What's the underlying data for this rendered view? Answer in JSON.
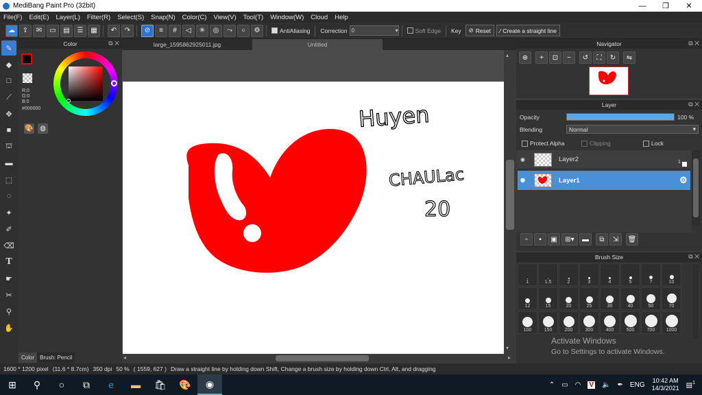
{
  "window": {
    "title": "MediBang Paint Pro (32bit)",
    "controls": [
      "—",
      "❐",
      "✕"
    ]
  },
  "menu": [
    "File(F)",
    "Edit(E)",
    "Layer(L)",
    "Filter(R)",
    "Select(S)",
    "Snap(N)",
    "Color(C)",
    "View(V)",
    "Tool(T)",
    "Window(W)",
    "Cloud",
    "Help"
  ],
  "toolbar": {
    "antialiasing": "AntiAliasing",
    "correction_label": "Correction",
    "correction_value": "0",
    "soft_edge": "Soft Edge",
    "key": "Key",
    "reset": "Reset",
    "straight_line": "Create a straight line"
  },
  "color_panel": {
    "title": "Color",
    "r": "R:0",
    "g": "G:0",
    "b": "B:0",
    "hex": "#000000",
    "tabs": [
      "Color",
      "Brush: Pencil"
    ]
  },
  "doc_tabs": [
    "large_1595862925011.jpg",
    "Untitled"
  ],
  "drawing_text": {
    "line1": "Huyen",
    "line2": "CHAULac",
    "line3": "20"
  },
  "navigator": {
    "title": "Navigator"
  },
  "layer_panel": {
    "title": "Layer",
    "opacity_label": "Opacity",
    "opacity_value": "100 %",
    "opacity_fraction": 1.0,
    "blending_label": "Blending",
    "blending_value": "Normal",
    "protect_alpha": "Protect Alpha",
    "clipping": "Clipping",
    "lock": "Lock",
    "layers": [
      "Layer2",
      "Layer1"
    ],
    "layer2_badge": "1"
  },
  "brush_panel": {
    "title": "Brush Size",
    "sizes": [
      "1",
      "1.5",
      "2",
      "3",
      "4",
      "5",
      "7",
      "10",
      "12",
      "15",
      "20",
      "25",
      "30",
      "40",
      "50",
      "70",
      "100",
      "150",
      "200",
      "300",
      "400",
      "500",
      "700",
      "1000"
    ]
  },
  "status": {
    "dimensions": "1600 * 1200 pixel",
    "physical": "(11.6 * 8.7cm)",
    "dpi": "350 dpi",
    "zoom": "50 %",
    "coords": "( 1559, 627 )",
    "hint": "Draw a straight line by holding down Shift, Change a brush size by holding down Ctrl, Alt, and dragging"
  },
  "watermark": {
    "title": "Activate Windows",
    "sub": "Go to Settings to activate Windows."
  },
  "taskbar": {
    "lang": "ENG",
    "time": "10:42 AM",
    "date": "14/3/2021",
    "notif_count": "1"
  },
  "colors": {
    "accent": "#3d7cd0",
    "heart": "#ff0000",
    "layer_selected": "#4a90d9"
  }
}
